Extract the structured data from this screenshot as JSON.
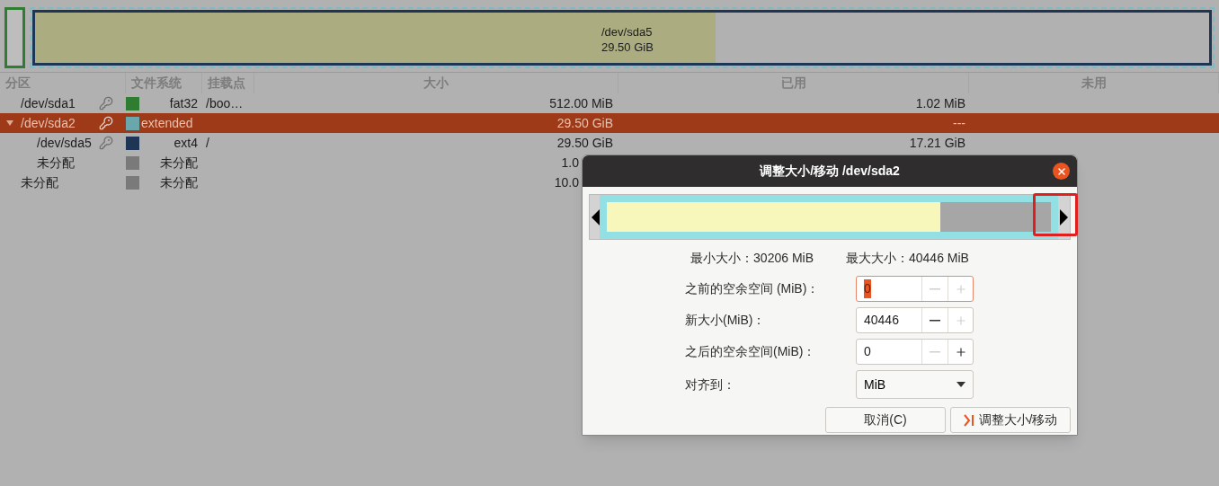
{
  "map": {
    "label": "/dev/sda5",
    "size": "29.50 GiB",
    "level": 0.58
  },
  "table": {
    "columns": [
      "分区",
      "文件系统",
      "挂载点",
      "大小",
      "已用",
      "未用"
    ],
    "rows": [
      {
        "name": "/dev/sda1",
        "busy": true,
        "color": "#2e7d32",
        "fs": "fat32",
        "mount": "/boo…",
        "size": "512.00 MiB",
        "used": "1.02 MiB",
        "selected": false
      },
      {
        "name": "/dev/sda2",
        "busy": true,
        "color": "#6aa7ad",
        "fs": "extended",
        "size": "29.50 GiB",
        "used": "---",
        "selected": true,
        "expanded": true,
        "children": [
          {
            "name": "/dev/sda5",
            "busy": true,
            "color": "#1e3555",
            "fs": "ext4",
            "mount": "/",
            "size": "29.50 GiB",
            "used": "17.21 GiB",
            "selected": false
          },
          {
            "name": "未分配",
            "busy": false,
            "color": "#7a7a7a",
            "fs": "未分配",
            "size": "1.0",
            "selected": false
          }
        ]
      },
      {
        "name": "未分配",
        "busy": false,
        "color": "#7a7a7a",
        "fs": "未分配",
        "size": "10.0",
        "selected": false
      }
    ]
  },
  "dialog": {
    "title": "调整大小/移动 /dev/sda2",
    "bar": {
      "level": 0.75,
      "right_highlighted": true
    },
    "min": "最小大小：30206 MiB",
    "max": "最大大小：40446 MiB",
    "fields": [
      {
        "kind": "spin",
        "label": "之前的空余空间 (MiB)：",
        "value": "0",
        "focused": true,
        "minus_disabled": true,
        "plus_disabled": true
      },
      {
        "kind": "spin",
        "label": "新大小(MiB)：",
        "value": "40446",
        "focused": false,
        "minus_disabled": false,
        "plus_disabled": true
      },
      {
        "kind": "spin",
        "label": "之后的空余空间(MiB)：",
        "value": "0",
        "focused": false,
        "minus_disabled": true,
        "plus_disabled": false
      },
      {
        "kind": "select",
        "label": "对齐到：",
        "value": "MiB"
      }
    ],
    "buttons": [
      {
        "kind": "cancel",
        "label": "取消(C)"
      },
      {
        "kind": "apply",
        "label": "调整大小/移动"
      }
    ]
  }
}
